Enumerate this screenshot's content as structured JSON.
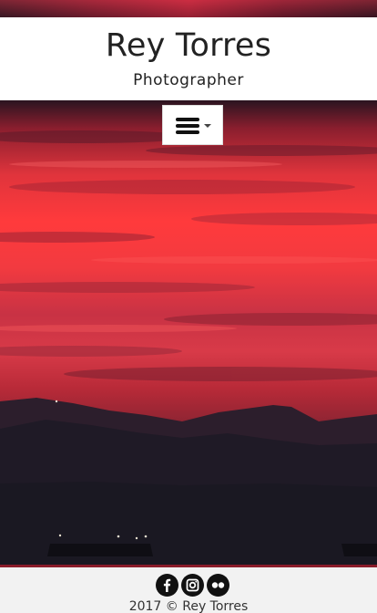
{
  "header": {
    "title": "Rey Torres",
    "subtitle": "Photographer"
  },
  "nav": {
    "toggle_icon": "hamburger-menu-icon"
  },
  "hero": {
    "description_colors": [
      "#ff3a3c",
      "#2a1c28"
    ]
  },
  "footer": {
    "social": [
      {
        "icon": "facebook-icon"
      },
      {
        "icon": "instagram-icon"
      },
      {
        "icon": "flickr-icon"
      }
    ],
    "copyright": "2017 © Rey Torres"
  }
}
